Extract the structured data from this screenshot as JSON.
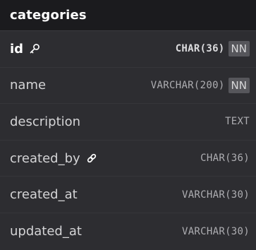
{
  "table": {
    "name": "categories",
    "columns": [
      {
        "name": "id",
        "type": "CHAR(36)",
        "badge": "NN",
        "icon": "key-icon",
        "primary": true
      },
      {
        "name": "name",
        "type": "VARCHAR(200)",
        "badge": "NN",
        "icon": null,
        "primary": false
      },
      {
        "name": "description",
        "type": "TEXT",
        "badge": null,
        "icon": null,
        "primary": false
      },
      {
        "name": "created_by",
        "type": "CHAR(36)",
        "badge": null,
        "icon": "link-icon",
        "primary": false
      },
      {
        "name": "created_at",
        "type": "VARCHAR(30)",
        "badge": null,
        "icon": null,
        "primary": false
      },
      {
        "name": "updated_at",
        "type": "VARCHAR(30)",
        "badge": null,
        "icon": null,
        "primary": false
      }
    ]
  },
  "colors": {
    "header_bg": "#1b1b1e",
    "body_bg": "#2d2d31",
    "badge_bg": "#56565b"
  }
}
